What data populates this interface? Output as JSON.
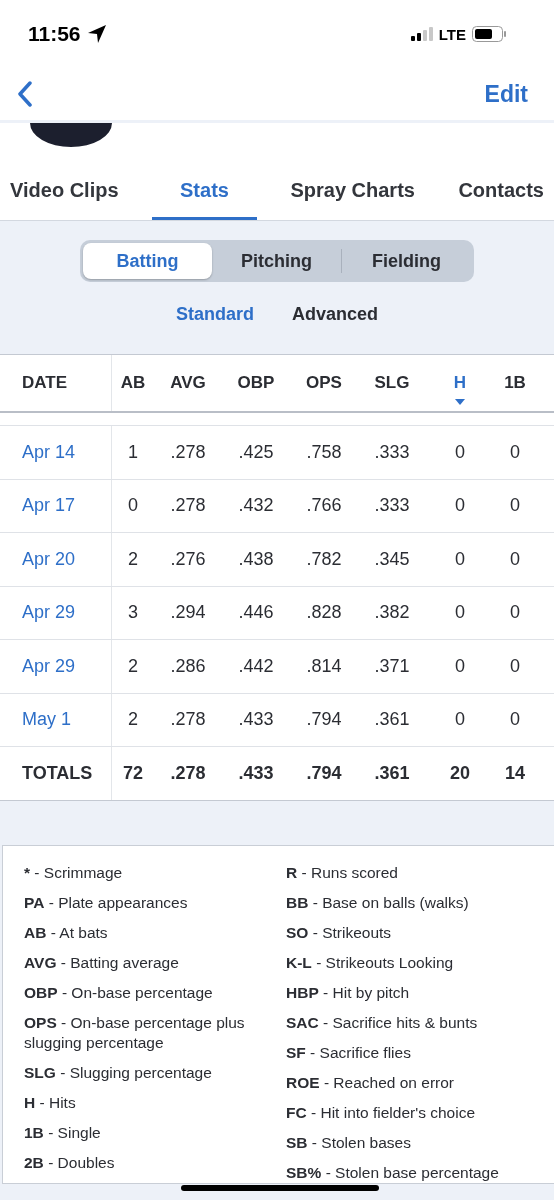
{
  "status_bar": {
    "time": "11:56",
    "network": "LTE"
  },
  "nav": {
    "action": "Edit"
  },
  "tabs": [
    {
      "label": "Video Clips",
      "selected": false
    },
    {
      "label": "Stats",
      "selected": true
    },
    {
      "label": "Spray Charts",
      "selected": false
    },
    {
      "label": "Contacts",
      "selected": false
    }
  ],
  "stat_groups": [
    {
      "label": "Batting",
      "selected": true
    },
    {
      "label": "Pitching",
      "selected": false
    },
    {
      "label": "Fielding",
      "selected": false
    }
  ],
  "views": [
    {
      "label": "Standard",
      "selected": true
    },
    {
      "label": "Advanced",
      "selected": false
    }
  ],
  "table": {
    "columns": [
      {
        "label": "DATE",
        "sorted": false
      },
      {
        "label": "AB",
        "sorted": false
      },
      {
        "label": "AVG",
        "sorted": false
      },
      {
        "label": "OBP",
        "sorted": false
      },
      {
        "label": "OPS",
        "sorted": false
      },
      {
        "label": "SLG",
        "sorted": false
      },
      {
        "label": "H",
        "sorted": true
      },
      {
        "label": "1B",
        "sorted": false
      }
    ],
    "rows": [
      {
        "cells": [
          "Apr 14",
          "1",
          ".278",
          ".425",
          ".758",
          ".333",
          "0",
          "0"
        ]
      },
      {
        "cells": [
          "Apr 17",
          "0",
          ".278",
          ".432",
          ".766",
          ".333",
          "0",
          "0"
        ]
      },
      {
        "cells": [
          "Apr 20",
          "2",
          ".276",
          ".438",
          ".782",
          ".345",
          "0",
          "0"
        ]
      },
      {
        "cells": [
          "Apr 29",
          "3",
          ".294",
          ".446",
          ".828",
          ".382",
          "0",
          "0"
        ]
      },
      {
        "cells": [
          "Apr 29",
          "2",
          ".286",
          ".442",
          ".814",
          ".371",
          "0",
          "0"
        ]
      },
      {
        "cells": [
          "May 1",
          "2",
          ".278",
          ".433",
          ".794",
          ".361",
          "0",
          "0"
        ]
      }
    ],
    "totals": {
      "cells": [
        "TOTALS",
        "72",
        ".278",
        ".433",
        ".794",
        ".361",
        "20",
        "14"
      ]
    }
  },
  "legend": {
    "left": [
      {
        "term": "*",
        "definition": "- Scrimmage"
      },
      {
        "term": "PA",
        "definition": "- Plate appearances"
      },
      {
        "term": "AB",
        "definition": "- At bats"
      },
      {
        "term": "AVG",
        "definition": "- Batting average"
      },
      {
        "term": "OBP",
        "definition": "- On-base percentage"
      },
      {
        "term": "OPS",
        "definition": "- On-base percentage plus slugging percentage"
      },
      {
        "term": "SLG",
        "definition": "- Slugging percentage"
      },
      {
        "term": "H",
        "definition": "- Hits"
      },
      {
        "term": "1B",
        "definition": "- Single"
      },
      {
        "term": "2B",
        "definition": "- Doubles"
      }
    ],
    "right": [
      {
        "term": "R",
        "definition": "- Runs scored"
      },
      {
        "term": "BB",
        "definition": "- Base on balls (walks)"
      },
      {
        "term": "SO",
        "definition": "- Strikeouts"
      },
      {
        "term": "K-L",
        "definition": "- Strikeouts Looking"
      },
      {
        "term": "HBP",
        "definition": "- Hit by pitch"
      },
      {
        "term": "SAC",
        "definition": "- Sacrifice hits & bunts"
      },
      {
        "term": "SF",
        "definition": "- Sacrifice flies"
      },
      {
        "term": "ROE",
        "definition": "- Reached on error"
      },
      {
        "term": "FC",
        "definition": "- Hit into fielder's choice"
      },
      {
        "term": "SB",
        "definition": "- Stolen bases"
      },
      {
        "term": "SB%",
        "definition": "- Stolen base percentage"
      }
    ]
  }
}
